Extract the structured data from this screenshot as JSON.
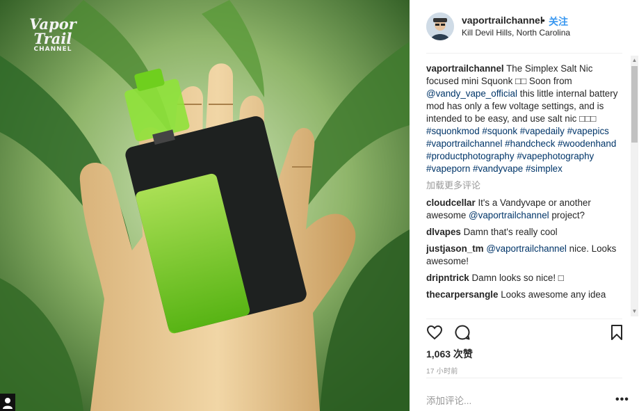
{
  "watermark": {
    "line1": "Vapor",
    "line2": "Trail",
    "line3": "CHANNEL"
  },
  "header": {
    "username": "vaportrailchannel",
    "separator": "•",
    "follow": "关注",
    "location": "Kill Devil Hills, North Carolina"
  },
  "caption": {
    "username": "vaportrailchannel",
    "text1": "The Simplex Salt Nic focused mini Squonk □□ Soon from",
    "mention": "@vandy_vape_official",
    "text2": "this little internal battery mod has only a few voltage settings, and is intended to be easy, and use salt nic □□□",
    "tags": [
      "#squonkmod",
      "#squonk",
      "#vapedaily",
      "#vapepics",
      "#vaportrailchannel",
      "#handcheck",
      "#woodenhand",
      "#productphotography",
      "#vapephotography",
      "#vapeporn",
      "#vandyvape",
      "#simplex"
    ]
  },
  "load_more": "加载更多评论",
  "comments": [
    {
      "user": "cloudcellar",
      "pre": "It's a Vandyvape or another awesome",
      "mention": "@vaportrailchannel",
      "post": "project?"
    },
    {
      "user": "dlvapes",
      "pre": "Damn that's really cool",
      "mention": "",
      "post": ""
    },
    {
      "user": "justjason_tm",
      "pre": "",
      "mention": "@vaportrailchannel",
      "post": "nice. Looks awesome!"
    },
    {
      "user": "dripntrick",
      "pre": "Damn looks so nice! □",
      "mention": "",
      "post": ""
    },
    {
      "user": "thecarpersangle",
      "pre": "Looks awesome any idea",
      "mention": "",
      "post": ""
    }
  ],
  "icons": {
    "like": "heart-icon",
    "comment": "comment-icon",
    "save": "bookmark-icon",
    "more": "more-options-icon"
  },
  "likes": "1,063 次赞",
  "time": "17 小时前",
  "add_comment_placeholder": "添加评论...",
  "more_label": "•••",
  "colors": {
    "link": "#003569",
    "follow": "#3897f0",
    "muted": "#999999",
    "text": "#262626"
  }
}
